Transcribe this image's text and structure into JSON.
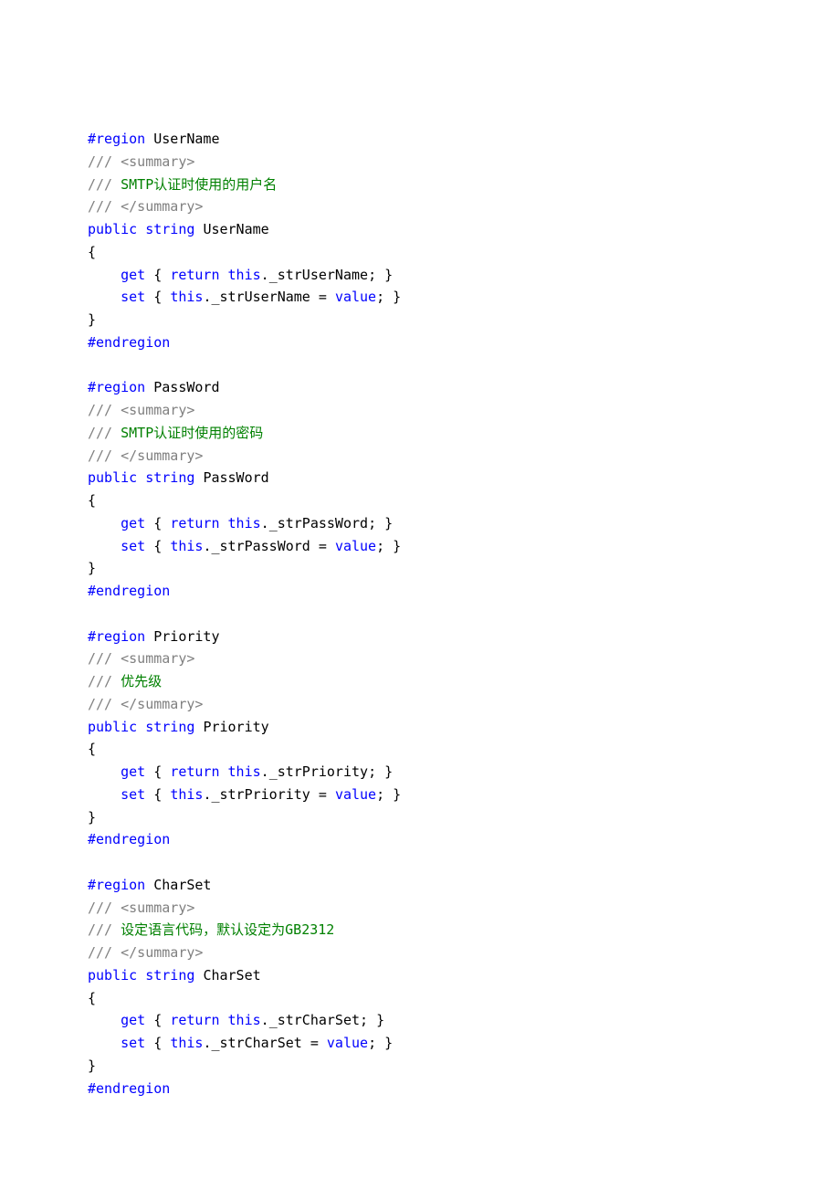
{
  "regions": [
    {
      "name": "UserName",
      "summary": "SMTP认证时使用的用户名",
      "propType": "string",
      "propName": "UserName",
      "field": "_strUserName"
    },
    {
      "name": "PassWord",
      "summary": "SMTP认证时使用的密码",
      "propType": "string",
      "propName": "PassWord",
      "field": "_strPassWord"
    },
    {
      "name": "Priority",
      "summary": "优先级",
      "propType": "string",
      "propName": "Priority",
      "field": "_strPriority"
    },
    {
      "name": "CharSet",
      "summary": "设定语言代码，默认设定为GB2312",
      "propType": "string",
      "propName": "CharSet",
      "field": "_strCharSet"
    }
  ],
  "tokens": {
    "region": "#region",
    "endregion": "#endregion",
    "public": "public",
    "get": "get",
    "set": "set",
    "return": "return",
    "this": "this",
    "value": "value",
    "summaryOpen": "/// <summary>",
    "summaryClose": "/// </summary>",
    "docPrefix": "/// "
  }
}
